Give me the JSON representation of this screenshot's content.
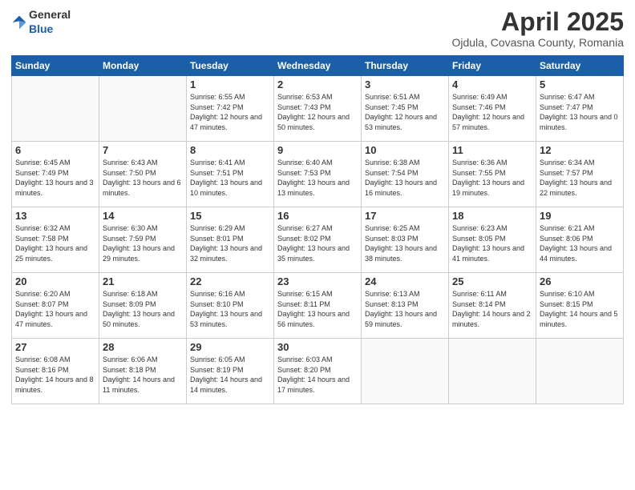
{
  "logo": {
    "general": "General",
    "blue": "Blue"
  },
  "title": {
    "month": "April 2025",
    "location": "Ojdula, Covasna County, Romania"
  },
  "weekdays": [
    "Sunday",
    "Monday",
    "Tuesday",
    "Wednesday",
    "Thursday",
    "Friday",
    "Saturday"
  ],
  "weeks": [
    [
      {
        "day": "",
        "sunrise": "",
        "sunset": "",
        "daylight": ""
      },
      {
        "day": "",
        "sunrise": "",
        "sunset": "",
        "daylight": ""
      },
      {
        "day": "1",
        "sunrise": "Sunrise: 6:55 AM",
        "sunset": "Sunset: 7:42 PM",
        "daylight": "Daylight: 12 hours and 47 minutes."
      },
      {
        "day": "2",
        "sunrise": "Sunrise: 6:53 AM",
        "sunset": "Sunset: 7:43 PM",
        "daylight": "Daylight: 12 hours and 50 minutes."
      },
      {
        "day": "3",
        "sunrise": "Sunrise: 6:51 AM",
        "sunset": "Sunset: 7:45 PM",
        "daylight": "Daylight: 12 hours and 53 minutes."
      },
      {
        "day": "4",
        "sunrise": "Sunrise: 6:49 AM",
        "sunset": "Sunset: 7:46 PM",
        "daylight": "Daylight: 12 hours and 57 minutes."
      },
      {
        "day": "5",
        "sunrise": "Sunrise: 6:47 AM",
        "sunset": "Sunset: 7:47 PM",
        "daylight": "Daylight: 13 hours and 0 minutes."
      }
    ],
    [
      {
        "day": "6",
        "sunrise": "Sunrise: 6:45 AM",
        "sunset": "Sunset: 7:49 PM",
        "daylight": "Daylight: 13 hours and 3 minutes."
      },
      {
        "day": "7",
        "sunrise": "Sunrise: 6:43 AM",
        "sunset": "Sunset: 7:50 PM",
        "daylight": "Daylight: 13 hours and 6 minutes."
      },
      {
        "day": "8",
        "sunrise": "Sunrise: 6:41 AM",
        "sunset": "Sunset: 7:51 PM",
        "daylight": "Daylight: 13 hours and 10 minutes."
      },
      {
        "day": "9",
        "sunrise": "Sunrise: 6:40 AM",
        "sunset": "Sunset: 7:53 PM",
        "daylight": "Daylight: 13 hours and 13 minutes."
      },
      {
        "day": "10",
        "sunrise": "Sunrise: 6:38 AM",
        "sunset": "Sunset: 7:54 PM",
        "daylight": "Daylight: 13 hours and 16 minutes."
      },
      {
        "day": "11",
        "sunrise": "Sunrise: 6:36 AM",
        "sunset": "Sunset: 7:55 PM",
        "daylight": "Daylight: 13 hours and 19 minutes."
      },
      {
        "day": "12",
        "sunrise": "Sunrise: 6:34 AM",
        "sunset": "Sunset: 7:57 PM",
        "daylight": "Daylight: 13 hours and 22 minutes."
      }
    ],
    [
      {
        "day": "13",
        "sunrise": "Sunrise: 6:32 AM",
        "sunset": "Sunset: 7:58 PM",
        "daylight": "Daylight: 13 hours and 25 minutes."
      },
      {
        "day": "14",
        "sunrise": "Sunrise: 6:30 AM",
        "sunset": "Sunset: 7:59 PM",
        "daylight": "Daylight: 13 hours and 29 minutes."
      },
      {
        "day": "15",
        "sunrise": "Sunrise: 6:29 AM",
        "sunset": "Sunset: 8:01 PM",
        "daylight": "Daylight: 13 hours and 32 minutes."
      },
      {
        "day": "16",
        "sunrise": "Sunrise: 6:27 AM",
        "sunset": "Sunset: 8:02 PM",
        "daylight": "Daylight: 13 hours and 35 minutes."
      },
      {
        "day": "17",
        "sunrise": "Sunrise: 6:25 AM",
        "sunset": "Sunset: 8:03 PM",
        "daylight": "Daylight: 13 hours and 38 minutes."
      },
      {
        "day": "18",
        "sunrise": "Sunrise: 6:23 AM",
        "sunset": "Sunset: 8:05 PM",
        "daylight": "Daylight: 13 hours and 41 minutes."
      },
      {
        "day": "19",
        "sunrise": "Sunrise: 6:21 AM",
        "sunset": "Sunset: 8:06 PM",
        "daylight": "Daylight: 13 hours and 44 minutes."
      }
    ],
    [
      {
        "day": "20",
        "sunrise": "Sunrise: 6:20 AM",
        "sunset": "Sunset: 8:07 PM",
        "daylight": "Daylight: 13 hours and 47 minutes."
      },
      {
        "day": "21",
        "sunrise": "Sunrise: 6:18 AM",
        "sunset": "Sunset: 8:09 PM",
        "daylight": "Daylight: 13 hours and 50 minutes."
      },
      {
        "day": "22",
        "sunrise": "Sunrise: 6:16 AM",
        "sunset": "Sunset: 8:10 PM",
        "daylight": "Daylight: 13 hours and 53 minutes."
      },
      {
        "day": "23",
        "sunrise": "Sunrise: 6:15 AM",
        "sunset": "Sunset: 8:11 PM",
        "daylight": "Daylight: 13 hours and 56 minutes."
      },
      {
        "day": "24",
        "sunrise": "Sunrise: 6:13 AM",
        "sunset": "Sunset: 8:13 PM",
        "daylight": "Daylight: 13 hours and 59 minutes."
      },
      {
        "day": "25",
        "sunrise": "Sunrise: 6:11 AM",
        "sunset": "Sunset: 8:14 PM",
        "daylight": "Daylight: 14 hours and 2 minutes."
      },
      {
        "day": "26",
        "sunrise": "Sunrise: 6:10 AM",
        "sunset": "Sunset: 8:15 PM",
        "daylight": "Daylight: 14 hours and 5 minutes."
      }
    ],
    [
      {
        "day": "27",
        "sunrise": "Sunrise: 6:08 AM",
        "sunset": "Sunset: 8:16 PM",
        "daylight": "Daylight: 14 hours and 8 minutes."
      },
      {
        "day": "28",
        "sunrise": "Sunrise: 6:06 AM",
        "sunset": "Sunset: 8:18 PM",
        "daylight": "Daylight: 14 hours and 11 minutes."
      },
      {
        "day": "29",
        "sunrise": "Sunrise: 6:05 AM",
        "sunset": "Sunset: 8:19 PM",
        "daylight": "Daylight: 14 hours and 14 minutes."
      },
      {
        "day": "30",
        "sunrise": "Sunrise: 6:03 AM",
        "sunset": "Sunset: 8:20 PM",
        "daylight": "Daylight: 14 hours and 17 minutes."
      },
      {
        "day": "",
        "sunrise": "",
        "sunset": "",
        "daylight": ""
      },
      {
        "day": "",
        "sunrise": "",
        "sunset": "",
        "daylight": ""
      },
      {
        "day": "",
        "sunrise": "",
        "sunset": "",
        "daylight": ""
      }
    ]
  ]
}
